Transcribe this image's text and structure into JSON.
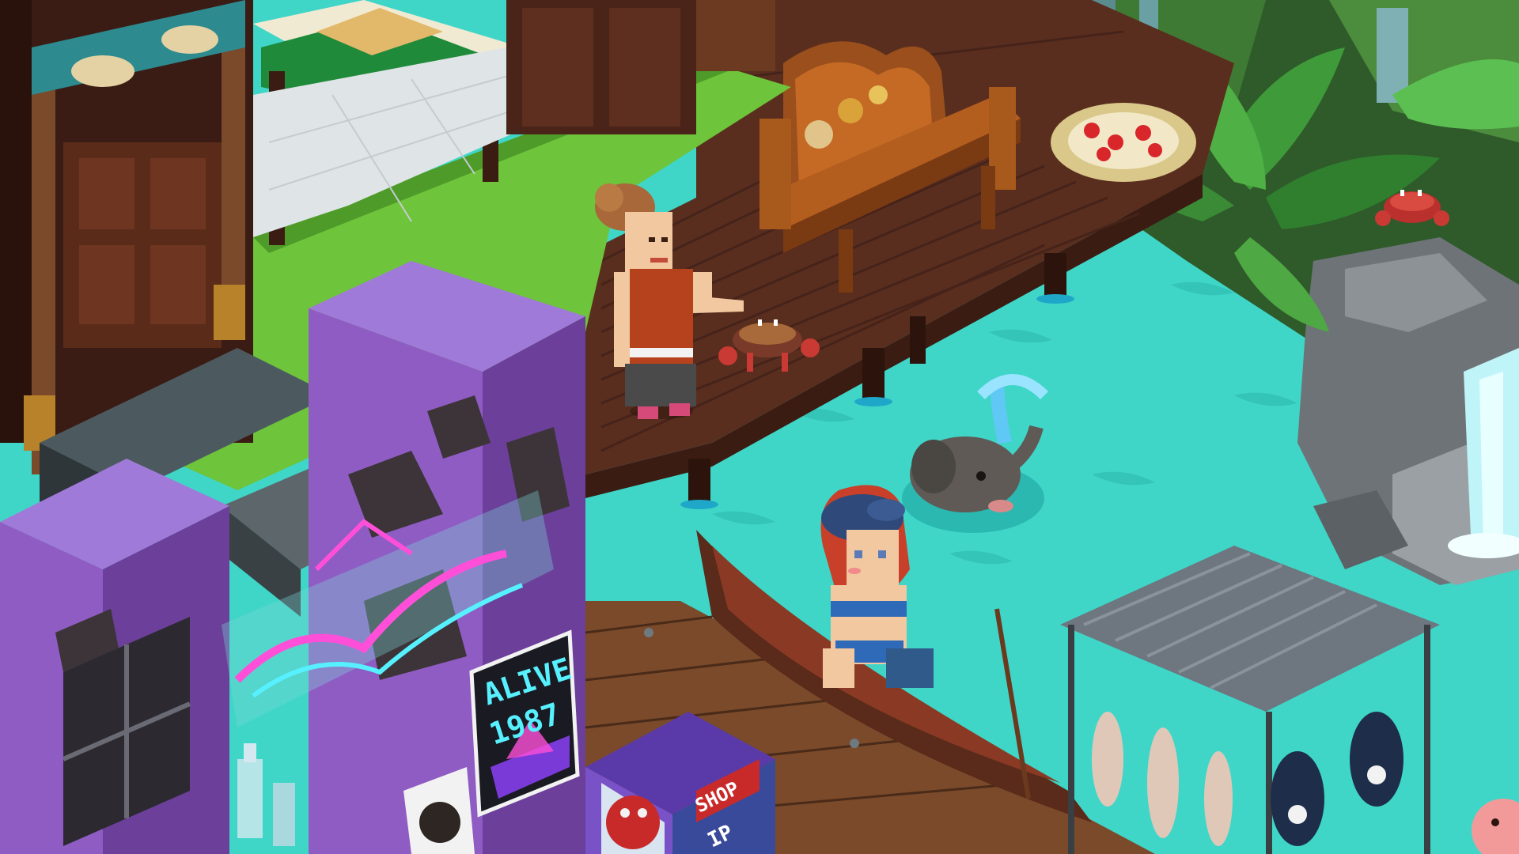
{
  "scene": {
    "kind": "isometric pixel-art hotel room",
    "colors": {
      "water": "#3fd6c8",
      "water_deep": "#2bb8b0",
      "grass": "#6ec43a",
      "grass_dark": "#4e9b2a",
      "deck": "#5a2e1e",
      "deck_dark": "#3b1c12",
      "purple_building": "#9a6ad0",
      "purple_dark": "#6b3f9a",
      "neon_pink": "#ff4fd8",
      "neon_cyan": "#56f0ff"
    }
  },
  "signs": {
    "poster_line1": "ALIVE",
    "poster_line2": "1987",
    "shop_sign": "SHOP",
    "shop_sub": "IP"
  },
  "avatars": [
    {
      "id": "avatar-woman-deck",
      "outfit": "orange top, gray skirt, brown bun hair"
    },
    {
      "id": "avatar-girl-boat",
      "outfit": "blue beret, red hair, blue bikini"
    }
  ],
  "pets": [
    {
      "id": "crab-pet-deck"
    },
    {
      "id": "elephant-pet-water"
    },
    {
      "id": "crab-pet-rocks"
    }
  ]
}
